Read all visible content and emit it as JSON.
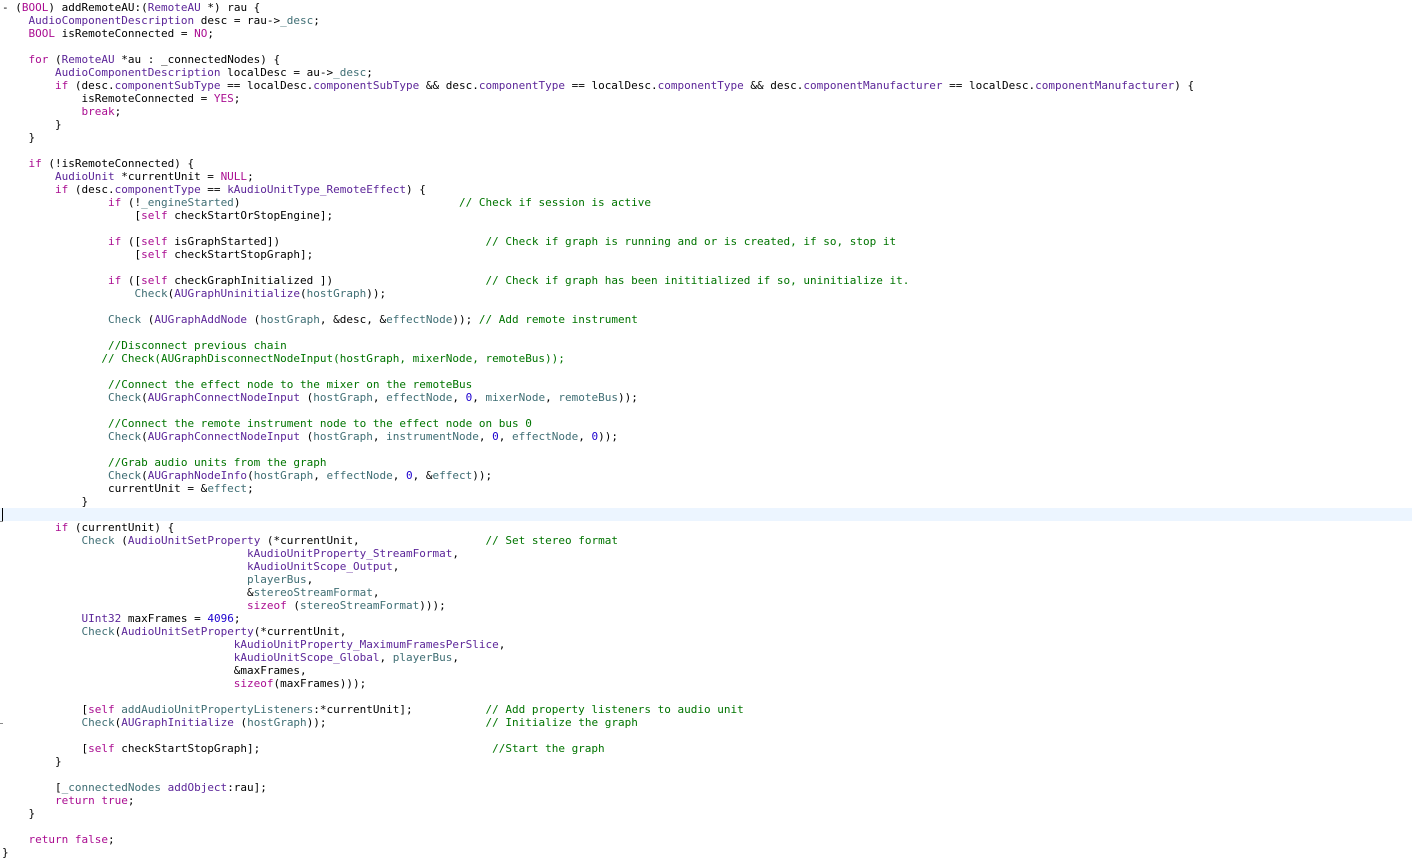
{
  "editor": {
    "language": "objective-c",
    "current_line_index": 39,
    "colors": {
      "background": "#ffffff",
      "current_line": "#ecf5ff",
      "plain": "#000000",
      "keyword": "#aa0d91",
      "type": "#5c2699",
      "project": "#3f6e74",
      "ivar": "#3f6e74",
      "macro": "#643820",
      "comment": "#007400",
      "number": "#1c00cf"
    },
    "lines": [
      [
        [
          "- (",
          "plain"
        ],
        [
          "BOOL",
          "keyword"
        ],
        [
          ") addRemoteAU:(",
          "plain"
        ],
        [
          "RemoteAU",
          "type"
        ],
        [
          " *) rau {",
          "plain"
        ]
      ],
      [
        [
          "    ",
          "plain"
        ],
        [
          "AudioComponentDescription",
          "type"
        ],
        [
          " desc = rau->",
          "plain"
        ],
        [
          "_desc",
          "ivar"
        ],
        [
          ";",
          "plain"
        ]
      ],
      [
        [
          "    ",
          "plain"
        ],
        [
          "BOOL",
          "keyword"
        ],
        [
          " isRemoteConnected = ",
          "plain"
        ],
        [
          "NO",
          "keyword"
        ],
        [
          ";",
          "plain"
        ]
      ],
      [],
      [
        [
          "    ",
          "plain"
        ],
        [
          "for",
          "keyword"
        ],
        [
          " (",
          "plain"
        ],
        [
          "RemoteAU",
          "type"
        ],
        [
          " *au : _connectedNodes) {",
          "plain"
        ]
      ],
      [
        [
          "        ",
          "plain"
        ],
        [
          "AudioComponentDescription",
          "type"
        ],
        [
          " localDesc = au->",
          "plain"
        ],
        [
          "_desc",
          "ivar"
        ],
        [
          ";",
          "plain"
        ]
      ],
      [
        [
          "        ",
          "plain"
        ],
        [
          "if",
          "keyword"
        ],
        [
          " (desc.",
          "plain"
        ],
        [
          "componentSubType",
          "type"
        ],
        [
          " == localDesc.",
          "plain"
        ],
        [
          "componentSubType",
          "type"
        ],
        [
          " && desc.",
          "plain"
        ],
        [
          "componentType",
          "type"
        ],
        [
          " == localDesc.",
          "plain"
        ],
        [
          "componentType",
          "type"
        ],
        [
          " && desc.",
          "plain"
        ],
        [
          "componentManufacturer",
          "type"
        ],
        [
          " == localDesc.",
          "plain"
        ],
        [
          "componentManufacturer",
          "type"
        ],
        [
          ") {",
          "plain"
        ]
      ],
      [
        [
          "            isRemoteConnected = ",
          "plain"
        ],
        [
          "YES",
          "keyword"
        ],
        [
          ";",
          "plain"
        ]
      ],
      [
        [
          "            ",
          "plain"
        ],
        [
          "break",
          "keyword"
        ],
        [
          ";",
          "plain"
        ]
      ],
      [
        [
          "        }",
          "plain"
        ]
      ],
      [
        [
          "    }",
          "plain"
        ]
      ],
      [],
      [
        [
          "    ",
          "plain"
        ],
        [
          "if",
          "keyword"
        ],
        [
          " (!isRemoteConnected) {",
          "plain"
        ]
      ],
      [
        [
          "        ",
          "plain"
        ],
        [
          "AudioUnit",
          "type"
        ],
        [
          " *currentUnit = ",
          "plain"
        ],
        [
          "NULL",
          "keyword"
        ],
        [
          ";",
          "plain"
        ]
      ],
      [
        [
          "        ",
          "plain"
        ],
        [
          "if",
          "keyword"
        ],
        [
          " (desc.",
          "plain"
        ],
        [
          "componentType",
          "type"
        ],
        [
          " == ",
          "plain"
        ],
        [
          "kAudioUnitType_RemoteEffect",
          "type"
        ],
        [
          ") {",
          "plain"
        ]
      ],
      [
        [
          "                ",
          "plain"
        ],
        [
          "if",
          "keyword"
        ],
        [
          " (!",
          "plain"
        ],
        [
          "_engineStarted",
          "ivar"
        ],
        [
          ")                                 ",
          "plain"
        ],
        [
          "// Check if session is active",
          "comment"
        ]
      ],
      [
        [
          "                    [",
          "plain"
        ],
        [
          "self",
          "keyword"
        ],
        [
          " checkStartOrStopEngine];",
          "plain"
        ]
      ],
      [],
      [
        [
          "                ",
          "plain"
        ],
        [
          "if",
          "keyword"
        ],
        [
          " ([",
          "plain"
        ],
        [
          "self",
          "keyword"
        ],
        [
          " isGraphStarted])                               ",
          "plain"
        ],
        [
          "// Check if graph is running and or is created, if so, stop it",
          "comment"
        ]
      ],
      [
        [
          "                    [",
          "plain"
        ],
        [
          "self",
          "keyword"
        ],
        [
          " checkStartStopGraph];",
          "plain"
        ]
      ],
      [],
      [
        [
          "                ",
          "plain"
        ],
        [
          "if",
          "keyword"
        ],
        [
          " ([",
          "plain"
        ],
        [
          "self",
          "keyword"
        ],
        [
          " checkGraphInitialized ])                       ",
          "plain"
        ],
        [
          "// Check if graph has been inititialized if so, uninitialize it.",
          "comment"
        ]
      ],
      [
        [
          "                    ",
          "plain"
        ],
        [
          "Check",
          "project"
        ],
        [
          "(",
          "plain"
        ],
        [
          "AUGraphUninitialize",
          "type"
        ],
        [
          "(",
          "plain"
        ],
        [
          "hostGraph",
          "ivar"
        ],
        [
          "));",
          "plain"
        ]
      ],
      [],
      [
        [
          "                ",
          "plain"
        ],
        [
          "Check",
          "project"
        ],
        [
          " (",
          "plain"
        ],
        [
          "AUGraphAddNode",
          "type"
        ],
        [
          " (",
          "plain"
        ],
        [
          "hostGraph",
          "ivar"
        ],
        [
          ", &desc, &",
          "plain"
        ],
        [
          "effectNode",
          "ivar"
        ],
        [
          ")); ",
          "plain"
        ],
        [
          "// Add remote instrument",
          "comment"
        ]
      ],
      [],
      [
        [
          "                ",
          "plain"
        ],
        [
          "//Disconnect previous chain",
          "comment"
        ]
      ],
      [
        [
          "               ",
          "plain"
        ],
        [
          "// Check(AUGraphDisconnectNodeInput(hostGraph, mixerNode, remoteBus));",
          "comment"
        ]
      ],
      [],
      [
        [
          "                ",
          "plain"
        ],
        [
          "//Connect the effect node to the mixer on the remoteBus",
          "comment"
        ]
      ],
      [
        [
          "                ",
          "plain"
        ],
        [
          "Check",
          "project"
        ],
        [
          "(",
          "plain"
        ],
        [
          "AUGraphConnectNodeInput",
          "type"
        ],
        [
          " (",
          "plain"
        ],
        [
          "hostGraph",
          "ivar"
        ],
        [
          ", ",
          "plain"
        ],
        [
          "effectNode",
          "ivar"
        ],
        [
          ", ",
          "plain"
        ],
        [
          "0",
          "number"
        ],
        [
          ", ",
          "plain"
        ],
        [
          "mixerNode",
          "ivar"
        ],
        [
          ", ",
          "plain"
        ],
        [
          "remoteBus",
          "ivar"
        ],
        [
          "));",
          "plain"
        ]
      ],
      [],
      [
        [
          "                ",
          "plain"
        ],
        [
          "//Connect the remote instrument node to the effect node on bus 0",
          "comment"
        ]
      ],
      [
        [
          "                ",
          "plain"
        ],
        [
          "Check",
          "project"
        ],
        [
          "(",
          "plain"
        ],
        [
          "AUGraphConnectNodeInput",
          "type"
        ],
        [
          " (",
          "plain"
        ],
        [
          "hostGraph",
          "ivar"
        ],
        [
          ", ",
          "plain"
        ],
        [
          "instrumentNode",
          "ivar"
        ],
        [
          ", ",
          "plain"
        ],
        [
          "0",
          "number"
        ],
        [
          ", ",
          "plain"
        ],
        [
          "effectNode",
          "ivar"
        ],
        [
          ", ",
          "plain"
        ],
        [
          "0",
          "number"
        ],
        [
          "));",
          "plain"
        ]
      ],
      [],
      [
        [
          "                ",
          "plain"
        ],
        [
          "//Grab audio units from the graph",
          "comment"
        ]
      ],
      [
        [
          "                ",
          "plain"
        ],
        [
          "Check",
          "project"
        ],
        [
          "(",
          "plain"
        ],
        [
          "AUGraphNodeInfo",
          "type"
        ],
        [
          "(",
          "plain"
        ],
        [
          "hostGraph",
          "ivar"
        ],
        [
          ", ",
          "plain"
        ],
        [
          "effectNode",
          "ivar"
        ],
        [
          ", ",
          "plain"
        ],
        [
          "0",
          "number"
        ],
        [
          ", &",
          "plain"
        ],
        [
          "effect",
          "ivar"
        ],
        [
          "));",
          "plain"
        ]
      ],
      [
        [
          "                currentUnit = &",
          "plain"
        ],
        [
          "effect",
          "ivar"
        ],
        [
          ";",
          "plain"
        ]
      ],
      [
        [
          "            }",
          "plain"
        ]
      ],
      [],
      [
        [
          "        ",
          "plain"
        ],
        [
          "if",
          "keyword"
        ],
        [
          " (currentUnit) {",
          "plain"
        ]
      ],
      [
        [
          "            ",
          "plain"
        ],
        [
          "Check",
          "project"
        ],
        [
          " (",
          "plain"
        ],
        [
          "AudioUnitSetProperty",
          "type"
        ],
        [
          " (*currentUnit,                   ",
          "plain"
        ],
        [
          "// Set stereo format",
          "comment"
        ]
      ],
      [
        [
          "                                     ",
          "plain"
        ],
        [
          "kAudioUnitProperty_StreamFormat",
          "type"
        ],
        [
          ",",
          "plain"
        ]
      ],
      [
        [
          "                                     ",
          "plain"
        ],
        [
          "kAudioUnitScope_Output",
          "type"
        ],
        [
          ",",
          "plain"
        ]
      ],
      [
        [
          "                                     ",
          "plain"
        ],
        [
          "playerBus",
          "ivar"
        ],
        [
          ",",
          "plain"
        ]
      ],
      [
        [
          "                                     &",
          "plain"
        ],
        [
          "stereoStreamFormat",
          "ivar"
        ],
        [
          ",",
          "plain"
        ]
      ],
      [
        [
          "                                     ",
          "plain"
        ],
        [
          "sizeof",
          "keyword"
        ],
        [
          " (",
          "plain"
        ],
        [
          "stereoStreamFormat",
          "ivar"
        ],
        [
          ")));",
          "plain"
        ]
      ],
      [
        [
          "            ",
          "plain"
        ],
        [
          "UInt32",
          "type"
        ],
        [
          " maxFrames = ",
          "plain"
        ],
        [
          "4096",
          "number"
        ],
        [
          ";",
          "plain"
        ]
      ],
      [
        [
          "            ",
          "plain"
        ],
        [
          "Check",
          "project"
        ],
        [
          "(",
          "plain"
        ],
        [
          "AudioUnitSetProperty",
          "type"
        ],
        [
          "(*currentUnit,",
          "plain"
        ]
      ],
      [
        [
          "                                   ",
          "plain"
        ],
        [
          "kAudioUnitProperty_MaximumFramesPerSlice",
          "type"
        ],
        [
          ",",
          "plain"
        ]
      ],
      [
        [
          "                                   ",
          "plain"
        ],
        [
          "kAudioUnitScope_Global",
          "type"
        ],
        [
          ", ",
          "plain"
        ],
        [
          "playerBus",
          "ivar"
        ],
        [
          ",",
          "plain"
        ]
      ],
      [
        [
          "                                   &maxFrames,",
          "plain"
        ]
      ],
      [
        [
          "                                   ",
          "plain"
        ],
        [
          "sizeof",
          "keyword"
        ],
        [
          "(maxFrames)));",
          "plain"
        ]
      ],
      [],
      [
        [
          "            [",
          "plain"
        ],
        [
          "self",
          "keyword"
        ],
        [
          " ",
          "plain"
        ],
        [
          "addAudioUnitPropertyListeners",
          "project"
        ],
        [
          ":*currentUnit];           ",
          "plain"
        ],
        [
          "// Add property listeners to audio unit",
          "comment"
        ]
      ],
      [
        [
          "            ",
          "plain"
        ],
        [
          "Check",
          "project"
        ],
        [
          "(",
          "plain"
        ],
        [
          "AUGraphInitialize",
          "type"
        ],
        [
          " (",
          "plain"
        ],
        [
          "hostGraph",
          "ivar"
        ],
        [
          "));                        ",
          "plain"
        ],
        [
          "// Initialize the graph",
          "comment"
        ]
      ],
      [],
      [
        [
          "            [",
          "plain"
        ],
        [
          "self",
          "keyword"
        ],
        [
          " checkStartStopGraph];                                   ",
          "plain"
        ],
        [
          "//Start the graph",
          "comment"
        ]
      ],
      [
        [
          "        }",
          "plain"
        ]
      ],
      [],
      [
        [
          "        [",
          "plain"
        ],
        [
          "_connectedNodes",
          "ivar"
        ],
        [
          " ",
          "plain"
        ],
        [
          "addObject",
          "type"
        ],
        [
          ":rau];",
          "plain"
        ]
      ],
      [
        [
          "        ",
          "plain"
        ],
        [
          "return",
          "keyword"
        ],
        [
          " ",
          "plain"
        ],
        [
          "true",
          "keyword"
        ],
        [
          ";",
          "plain"
        ]
      ],
      [
        [
          "    }",
          "plain"
        ]
      ],
      [],
      [
        [
          "    ",
          "plain"
        ],
        [
          "return",
          "keyword"
        ],
        [
          " ",
          "plain"
        ],
        [
          "false",
          "keyword"
        ],
        [
          ";",
          "plain"
        ]
      ],
      [
        [
          "}",
          "plain"
        ]
      ]
    ]
  }
}
